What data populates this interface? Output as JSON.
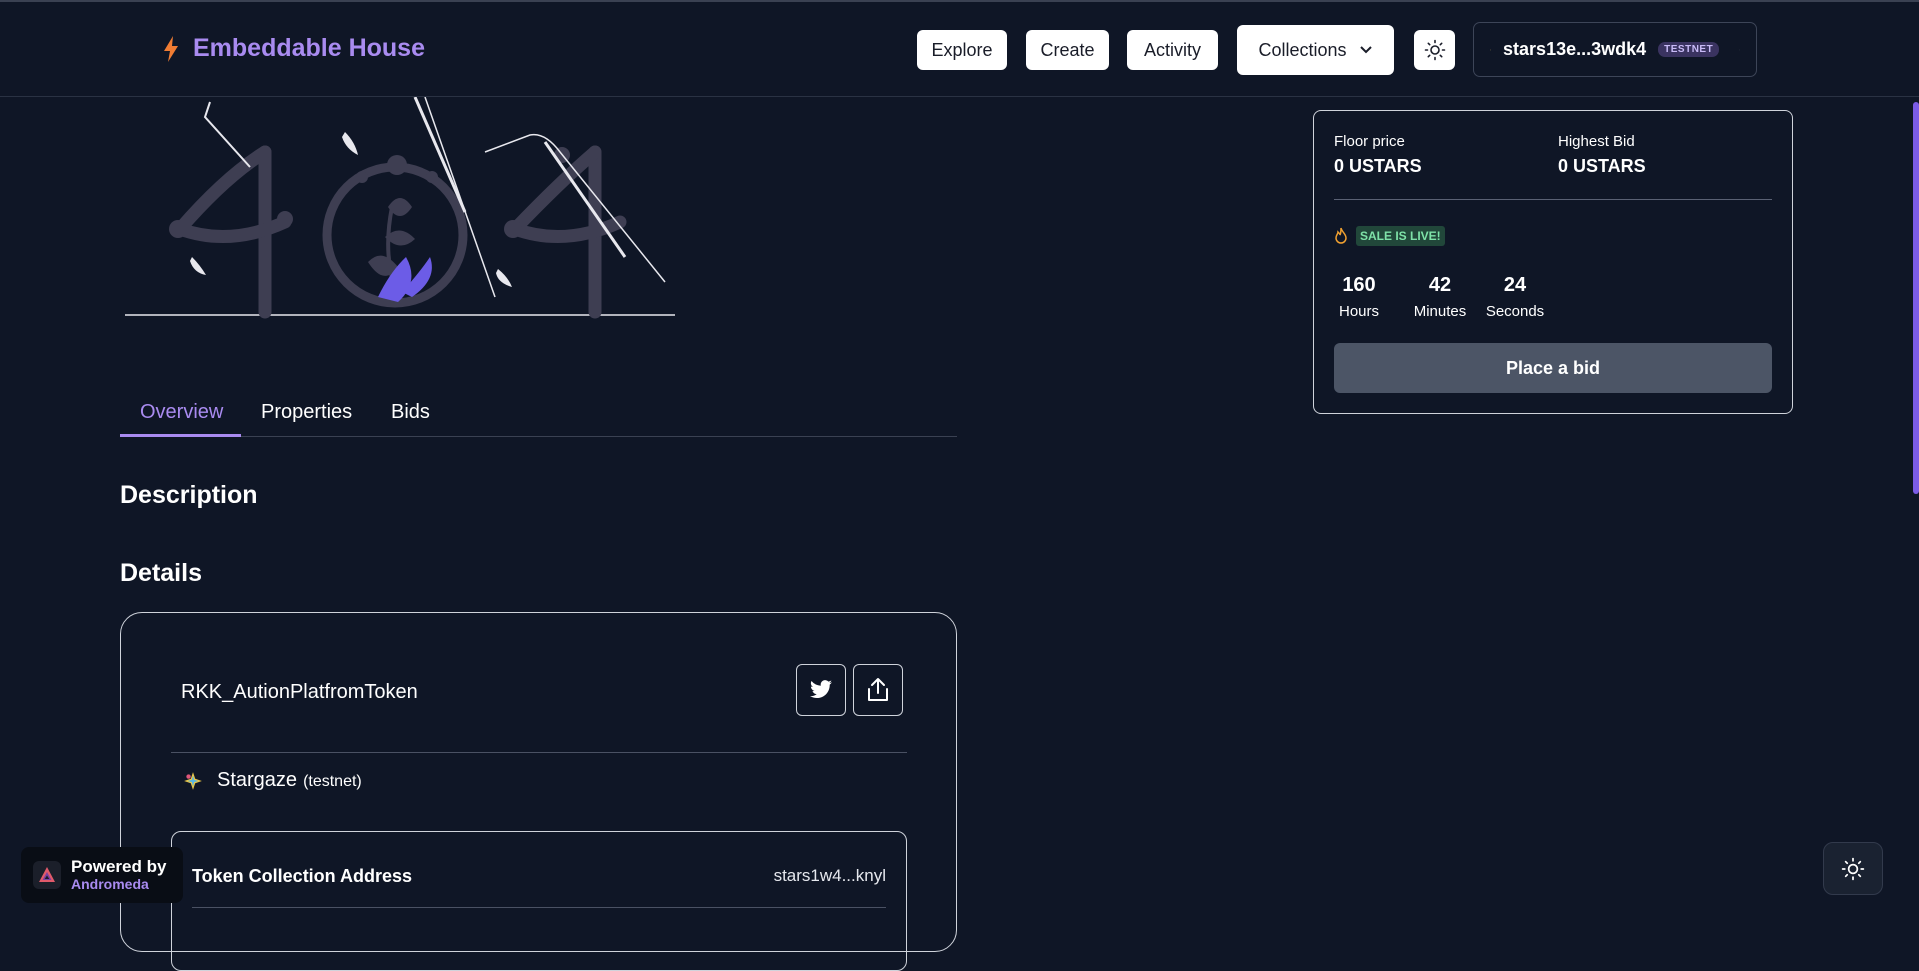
{
  "header": {
    "brand_name": "Embeddable House",
    "nav": {
      "explore": "Explore",
      "create": "Create",
      "activity": "Activity",
      "collections": "Collections"
    },
    "wallet": {
      "address": "stars13e...3wdk4",
      "network_badge": "TESTNET"
    }
  },
  "hero": {
    "illustration": "404 illustration"
  },
  "tabs": {
    "overview": "Overview",
    "properties": "Properties",
    "bids": "Bids",
    "active": "Overview"
  },
  "main": {
    "description_heading": "Description",
    "details_heading": "Details"
  },
  "details": {
    "token_name": "RKK_AutionPlatfromToken",
    "chain_name": "Stargaze",
    "chain_network": "(testnet)",
    "address_label": "Token Collection Address",
    "address_value": "stars1w4...knyl"
  },
  "sale": {
    "floor_price_label": "Floor price",
    "floor_price_value": "0 USTARS",
    "highest_bid_label": "Highest Bid",
    "highest_bid_value": "0 USTARS",
    "status": "SALE IS LIVE!",
    "timer": {
      "hours": "160",
      "hours_label": "Hours",
      "minutes": "42",
      "minutes_label": "Minutes",
      "seconds": "24",
      "seconds_label": "Seconds"
    },
    "place_bid": "Place a bid"
  },
  "footer": {
    "powered_by": "Powered by",
    "powered_name": "Andromeda"
  },
  "colors": {
    "background": "#0f1626",
    "accent": "#a98bf0",
    "brand_bolt": "#f07c33",
    "live_badge_bg": "#21473a",
    "live_badge_text": "#7ee2a8",
    "bid_button": "#4c5566"
  },
  "icons": {
    "brand": "bolt-icon",
    "collections_chevron": "chevron-down-icon",
    "theme": "sun-icon",
    "wallet_chain": "stargaze-icon",
    "wallet_chevron": "chevron-down-icon",
    "twitter": "twitter-icon",
    "share": "share-icon",
    "fire": "fire-icon"
  }
}
